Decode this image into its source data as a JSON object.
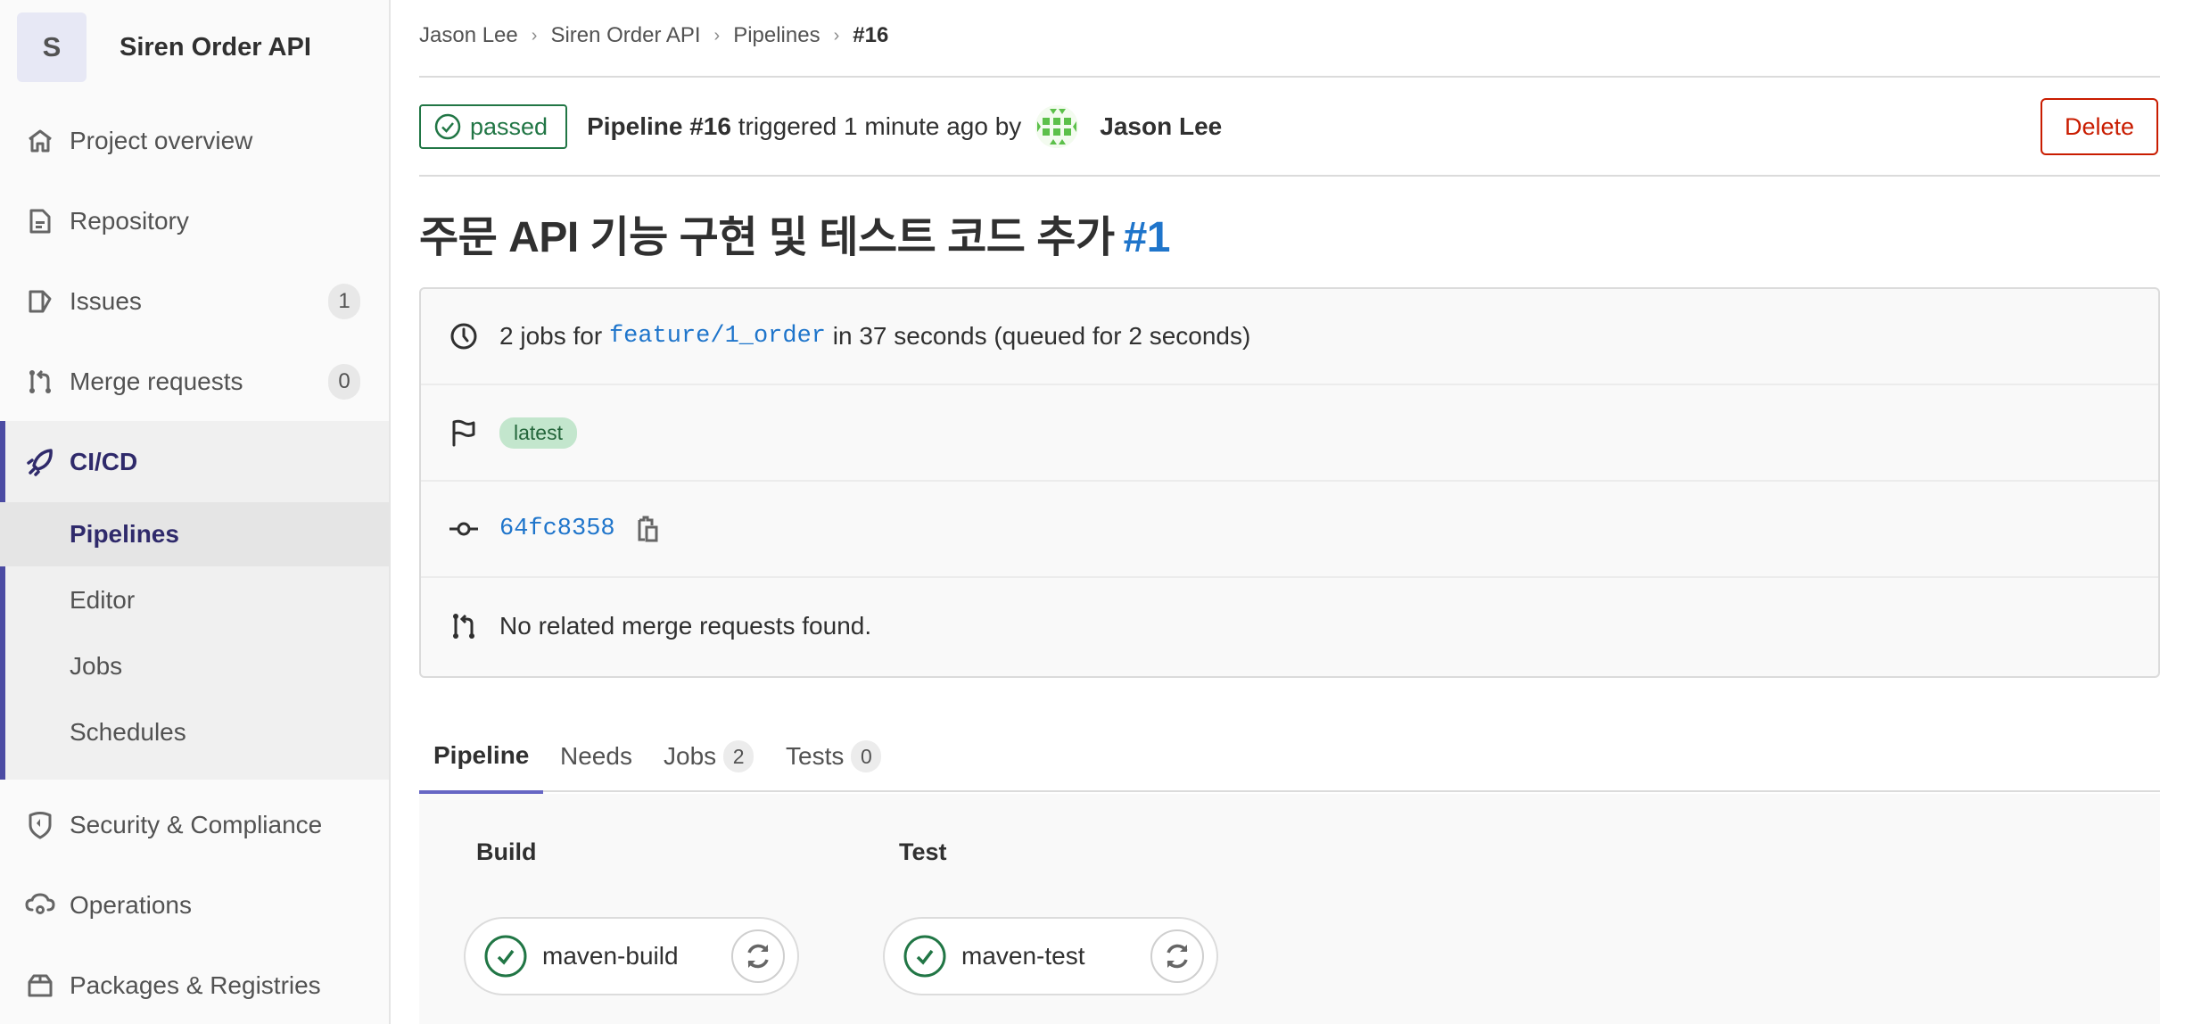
{
  "sidebar": {
    "project_initial": "S",
    "project_name": "Siren Order API",
    "items": [
      {
        "label": "Project overview",
        "icon": "home-icon"
      },
      {
        "label": "Repository",
        "icon": "document-icon"
      },
      {
        "label": "Issues",
        "icon": "issues-icon",
        "count": "1"
      },
      {
        "label": "Merge requests",
        "icon": "merge-request-icon",
        "count": "0"
      },
      {
        "label": "CI/CD",
        "icon": "rocket-icon"
      },
      {
        "label": "Security & Compliance",
        "icon": "shield-icon"
      },
      {
        "label": "Operations",
        "icon": "cloud-gear-icon"
      },
      {
        "label": "Packages & Registries",
        "icon": "package-icon"
      }
    ],
    "cicd_subitems": [
      {
        "label": "Pipelines",
        "active": true
      },
      {
        "label": "Editor"
      },
      {
        "label": "Jobs"
      },
      {
        "label": "Schedules"
      }
    ]
  },
  "breadcrumb": [
    "Jason Lee",
    "Siren Order API",
    "Pipelines",
    "#16"
  ],
  "header": {
    "status": "passed",
    "pipeline_label": "Pipeline #16",
    "triggered_text": "triggered 1 minute ago by",
    "user_name": "Jason Lee",
    "delete_label": "Delete"
  },
  "title": {
    "text": "주문 API 기능 구현 및 테스트 코드 추가",
    "issue_ref": "#1"
  },
  "info": {
    "jobs_prefix": "2 jobs for",
    "branch": "feature/1_order",
    "jobs_suffix": "in 37 seconds (queued for 2 seconds)",
    "tag": "latest",
    "commit_sha": "64fc8358",
    "merge_requests": "No related merge requests found."
  },
  "tabs": [
    {
      "label": "Pipeline",
      "active": true
    },
    {
      "label": "Needs"
    },
    {
      "label": "Jobs",
      "count": "2"
    },
    {
      "label": "Tests",
      "count": "0"
    }
  ],
  "stages": [
    {
      "name": "Build",
      "jobs": [
        {
          "name": "maven-build",
          "status": "success"
        }
      ]
    },
    {
      "name": "Test",
      "jobs": [
        {
          "name": "maven-test",
          "status": "success"
        }
      ]
    }
  ],
  "colors": {
    "success": "#217645",
    "link": "#1f75cb",
    "danger": "#c91c00",
    "nav_active": "#2f2a6b",
    "tab_indicator": "#6666c4"
  }
}
